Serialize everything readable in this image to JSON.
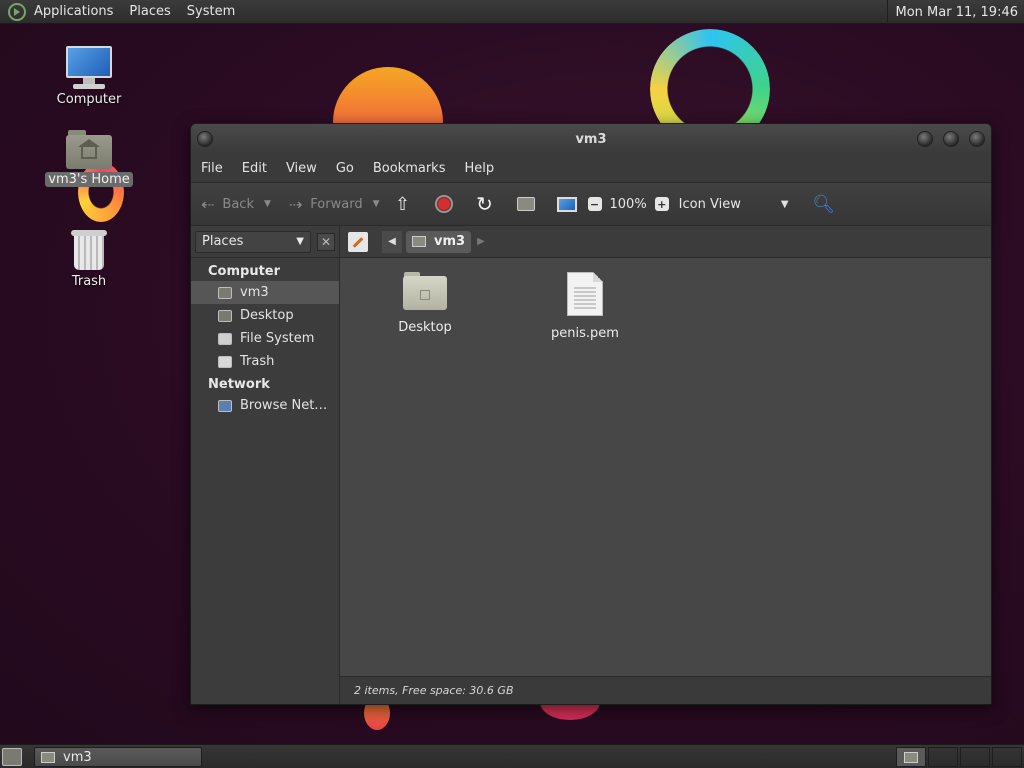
{
  "top_panel": {
    "menus": [
      "Applications",
      "Places",
      "System"
    ],
    "clock": "Mon Mar 11, 19:46"
  },
  "desktop_icons": {
    "computer": "Computer",
    "home": "vm3's Home",
    "trash": "Trash"
  },
  "window": {
    "title": "vm3",
    "menubar": [
      "File",
      "Edit",
      "View",
      "Go",
      "Bookmarks",
      "Help"
    ],
    "toolbar": {
      "back": "Back",
      "forward": "Forward",
      "zoom": "100%",
      "view_mode": "Icon View"
    },
    "sidebar": {
      "selector": "Places",
      "sections": [
        {
          "title": "Computer",
          "items": [
            "vm3",
            "Desktop",
            "File System",
            "Trash"
          ]
        },
        {
          "title": "Network",
          "items": [
            "Browse Net…"
          ]
        }
      ],
      "active_item": "vm3"
    },
    "pathbar": {
      "current": "vm3"
    },
    "files": [
      {
        "name": "Desktop",
        "type": "folder"
      },
      {
        "name": "penis.pem",
        "type": "document"
      }
    ],
    "status": "2 items, Free space: 30.6 GB"
  },
  "bottom_panel": {
    "task": "vm3"
  }
}
